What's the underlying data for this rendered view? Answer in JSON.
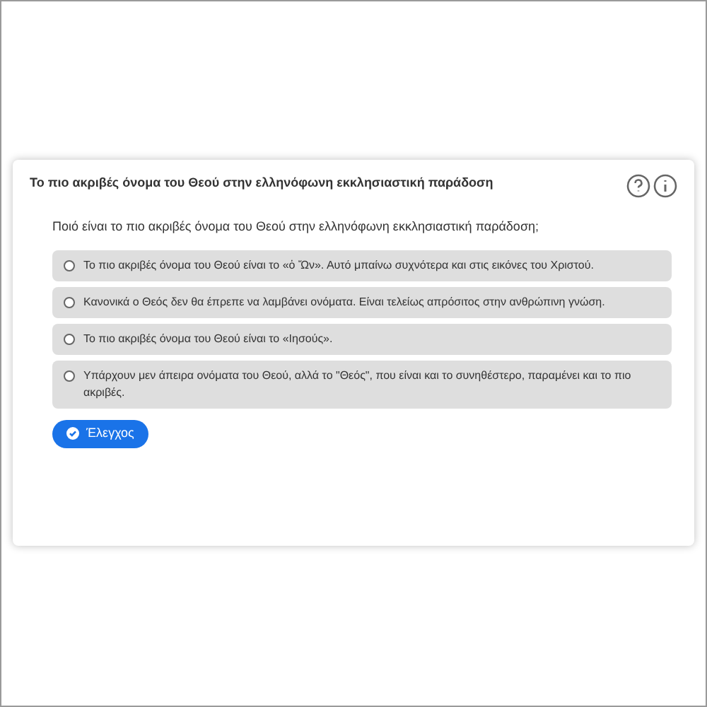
{
  "card": {
    "title": "Το πιο ακριβές όνομα του Θεού στην ελληνόφωνη εκκλησιαστική παράδοση"
  },
  "question": "Ποιό είναι το πιο ακριβές όνομα του Θεού στην ελληνόφωνη εκκλησιαστική παράδοση;",
  "options": [
    {
      "label": "Το πιο ακριβές όνομα του Θεού είναι το «ὁ Ὤν». Αυτό μπαίνω συχνότερα και στις εικόνες του Χριστού.",
      "selected": false
    },
    {
      "label": "Κανονικά ο Θεός δεν θα έπρεπε να λαμβάνει ονόματα. Είναι τελείως απρόσιτος στην ανθρώπινη γνώση.",
      "selected": false
    },
    {
      "label": "Το πιο ακριβές όνομα του Θεού είναι το «Ιησούς».",
      "selected": false
    },
    {
      "label": "Υπάρχουν μεν άπειρα ονόματα του Θεού, αλλά το \"Θεός\", που είναι και το συνηθέστερο, παραμένει και το πιο ακριβές.",
      "selected": false
    }
  ],
  "check_button": "Έλεγχος"
}
